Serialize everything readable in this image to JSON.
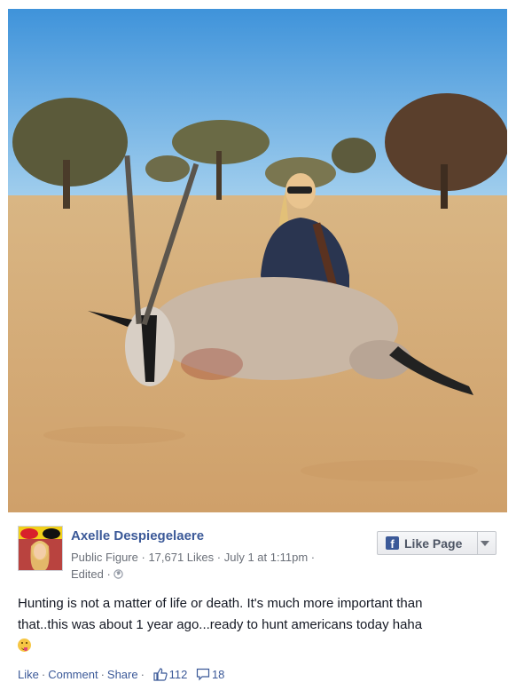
{
  "post": {
    "author": "Axelle Despiegelaere",
    "category": "Public Figure",
    "likes": "17,671 Likes",
    "date": "July 1 at 1:11pm",
    "edited": "Edited",
    "text_line1": "Hunting is not a matter of life or death. It's much more important than",
    "text_line2": "that..this was about 1 year ago...ready to hunt americans today haha",
    "emoji_icon": "tongue-out-emoji"
  },
  "like_page": {
    "label": "Like Page",
    "logo": "f"
  },
  "actions": {
    "like": "Like",
    "comment": "Comment",
    "share": "Share",
    "like_count": "112",
    "comment_count": "18"
  },
  "colors": {
    "link": "#3b5998",
    "meta": "#6b7079",
    "text": "#141823"
  }
}
